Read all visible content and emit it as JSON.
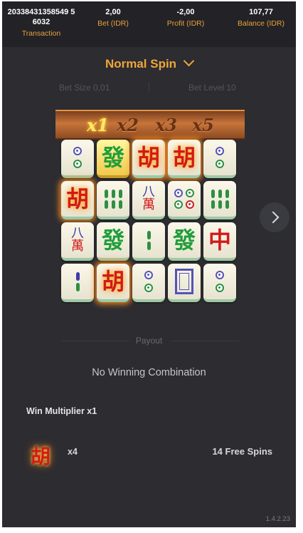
{
  "header": {
    "transaction": {
      "value": "20338431358549 56032",
      "label": "Transaction"
    },
    "bet": {
      "value": "2,00",
      "label": "Bet (IDR)"
    },
    "profit": {
      "value": "-2,00",
      "label": "Profit (IDR)"
    },
    "balance": {
      "value": "107,77",
      "label": "Balance (IDR)"
    }
  },
  "spin_mode": "Normal Spin",
  "bet_size": "Bet Size 0,01",
  "bet_level": "Bet Level 10",
  "multipliers": [
    "x1",
    "x2",
    "x3",
    "x5"
  ],
  "active_multiplier": "x1",
  "grid": {
    "rows": [
      [
        "2 circles",
        "發 (gold)",
        "胡",
        "胡",
        "2 circles"
      ],
      [
        "胡",
        "6 bamboo",
        "八萬",
        "5 circles",
        "6 bamboo"
      ],
      [
        "八萬",
        "發",
        "2 bamboo",
        "發",
        "中"
      ],
      [
        "2 bamboo",
        "胡",
        "2 circles",
        "white dragon",
        "2 circles"
      ]
    ]
  },
  "payout_label": "Payout",
  "result_text": "No Winning Combination",
  "win_multiplier": "Win Multiplier x1",
  "scatter": {
    "glyph": "胡",
    "count": "x4",
    "free_spins": "14 Free Spins"
  },
  "version": "1.4.2.23",
  "colors": {
    "accent": "#f0a638",
    "background": "#2c2c31",
    "header": "#232327"
  }
}
